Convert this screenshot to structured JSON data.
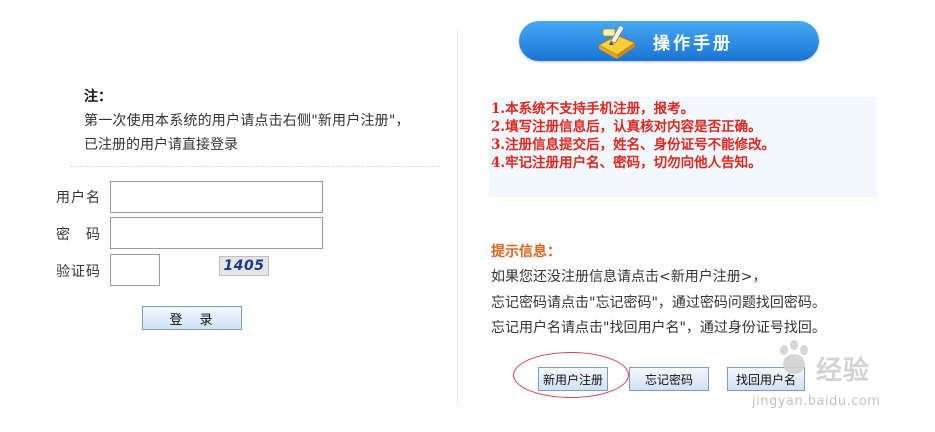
{
  "left": {
    "note_title": "注：",
    "note_line1": "第一次使用本系统的用户请点击右侧\"新用户注册\"，",
    "note_line2": "已注册的用户请直接登录",
    "username_label": "用户名",
    "password_label": "密　码",
    "captcha_label": "验证码",
    "username_value": "",
    "password_value": "",
    "captcha_value": "",
    "captcha_image_text": "1405",
    "login_button": "登　录"
  },
  "right": {
    "manual_title": "操作手册",
    "rules": [
      "1.本系统不支持手机注册，报考。",
      "2.填写注册信息后，认真核对内容是否正确。",
      "3.注册信息提交后，姓名、身份证号不能修改。",
      "4.牢记注册用户名、密码，切勿向他人告知。"
    ],
    "tip_title": "提示信息：",
    "tips": [
      "如果您还没注册信息请点击<新用户注册>，",
      "忘记密码请点击\"忘记密码\"，通过密码问题找回密码。",
      "忘记用户名请点击\"找回用户名\"，通过身份证号找回。"
    ],
    "buttons": {
      "register": "新用户注册",
      "forgot_password": "忘记密码",
      "find_username": "找回用户名"
    }
  },
  "watermark": {
    "brand": "经验",
    "url": "jingyan.baidu.com"
  },
  "colors": {
    "banner_top": "#45a9f2",
    "banner_bottom": "#1a74d6",
    "rule_text": "#e0281e",
    "tip_title": "#d9651f",
    "rules_bg": "#f1f8fe",
    "highlight_ring": "#d94448"
  },
  "icons": {
    "manual_icon": "book-pencil-icon",
    "watermark_icon": "baidu-paw-icon"
  }
}
